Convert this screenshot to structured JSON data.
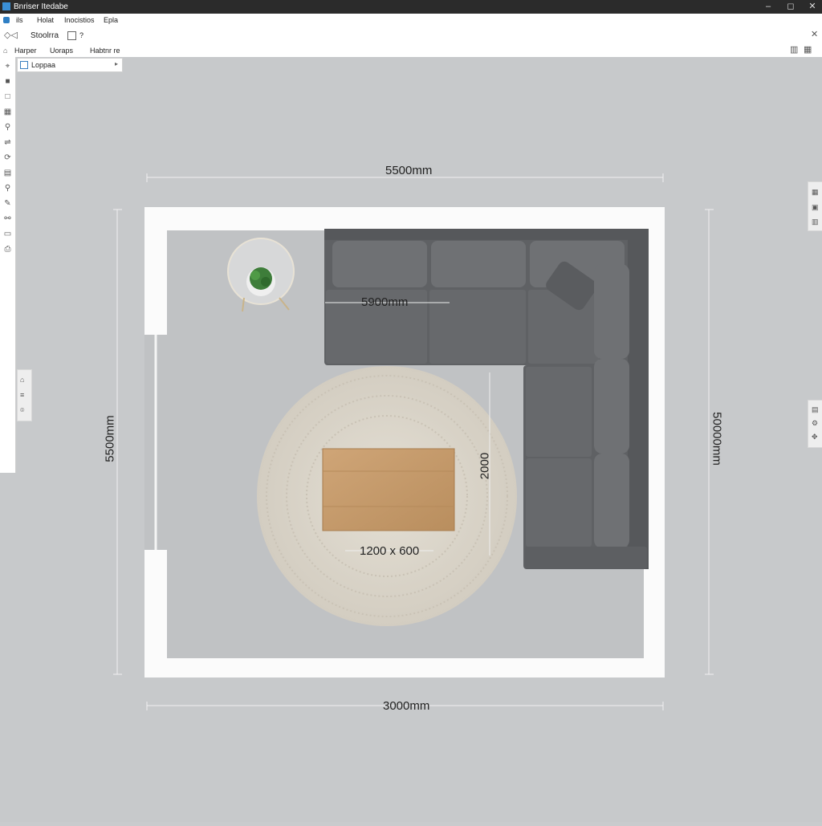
{
  "window": {
    "title": "Bnriser Itedabe",
    "minimize": "–",
    "maximize": "◻",
    "close": "✕"
  },
  "menu": {
    "items": [
      "ils",
      "Holat",
      "Inocistios",
      "Epla"
    ]
  },
  "toolbar": {
    "label": "Stoolrra",
    "extra": "?"
  },
  "tabs": {
    "items": [
      "Harper",
      "Uoraps",
      "Habtnr re"
    ]
  },
  "layer_panel": {
    "label": "Loppaa"
  },
  "plan": {
    "dims": {
      "top": "5500mm",
      "bottom": "3000mm",
      "left": "5500mm",
      "right": "50000mm",
      "sofa": "5900mm",
      "rug": "2000",
      "table": "1200 x 600"
    },
    "colors": {
      "wall": "#fafafa",
      "floor": "#bfc1c3",
      "sofa": "#6b6d70",
      "rug": "#dcd6ca",
      "table": "#c49a6c"
    }
  }
}
